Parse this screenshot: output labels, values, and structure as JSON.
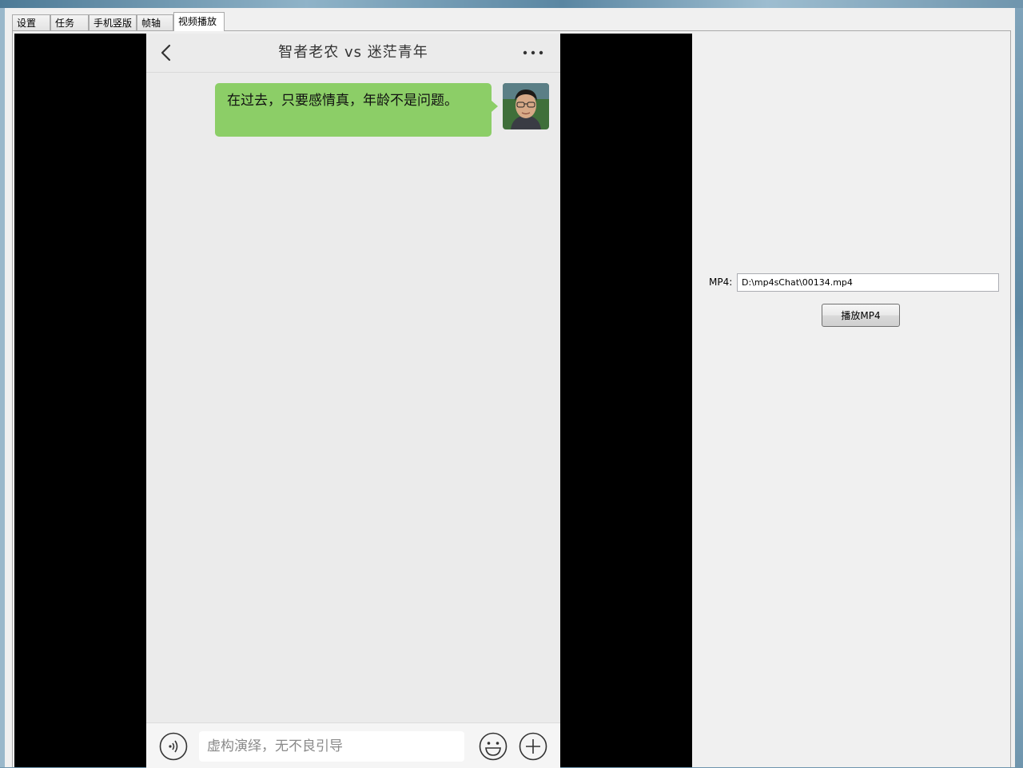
{
  "tabs": [
    {
      "label": "设置"
    },
    {
      "label": "任务"
    },
    {
      "label": "手机竖版"
    },
    {
      "label": "帧轴"
    },
    {
      "label": "视频播放"
    }
  ],
  "active_tab": "视频播放",
  "chat": {
    "title": "智者老农  vs  迷茫青年",
    "messages": [
      {
        "sender": "self",
        "text": "在过去，只要感情真，年龄不是问题。"
      }
    ],
    "input_placeholder": "虚构演绎，无不良引导"
  },
  "player": {
    "mp4_label": "MP4:",
    "mp4_path": "D:\\mp4sChat\\00134.mp4",
    "play_button": "播放MP4"
  },
  "colors": {
    "bubble": "#8cce67",
    "chat_background": "#ebebeb",
    "video_letterbox": "#000000"
  },
  "icons": [
    "back-arrow-icon",
    "more-dots-icon",
    "voice-icon",
    "emoji-icon",
    "plus-icon",
    "avatar-photo"
  ]
}
